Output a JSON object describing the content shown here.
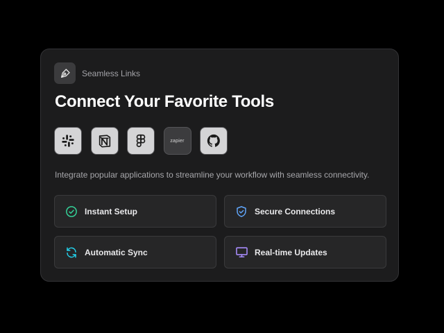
{
  "brand": {
    "name": "Seamless Links",
    "icon": "pen-nib-icon"
  },
  "title": "Connect Your Favorite Tools",
  "tools": [
    {
      "name": "Slack",
      "icon": "slack-icon"
    },
    {
      "name": "Notion",
      "icon": "notion-icon"
    },
    {
      "name": "Figma",
      "icon": "figma-icon"
    },
    {
      "name": "Zapier",
      "icon": "zapier-icon",
      "text": "zapier"
    },
    {
      "name": "GitHub",
      "icon": "github-icon"
    }
  ],
  "description": "Integrate popular applications to streamline your workflow with seamless connectivity.",
  "features": [
    {
      "label": "Instant Setup",
      "icon": "check-circle-icon",
      "color": "#34d399"
    },
    {
      "label": "Secure Connections",
      "icon": "shield-check-icon",
      "color": "#60a5fa"
    },
    {
      "label": "Automatic Sync",
      "icon": "refresh-icon",
      "color": "#22d3ee"
    },
    {
      "label": "Real-time Updates",
      "icon": "monitor-icon",
      "color": "#a78bfa"
    }
  ],
  "colors": {
    "background": "#000000",
    "card": "#1c1c1d",
    "feature_card": "#262627"
  }
}
